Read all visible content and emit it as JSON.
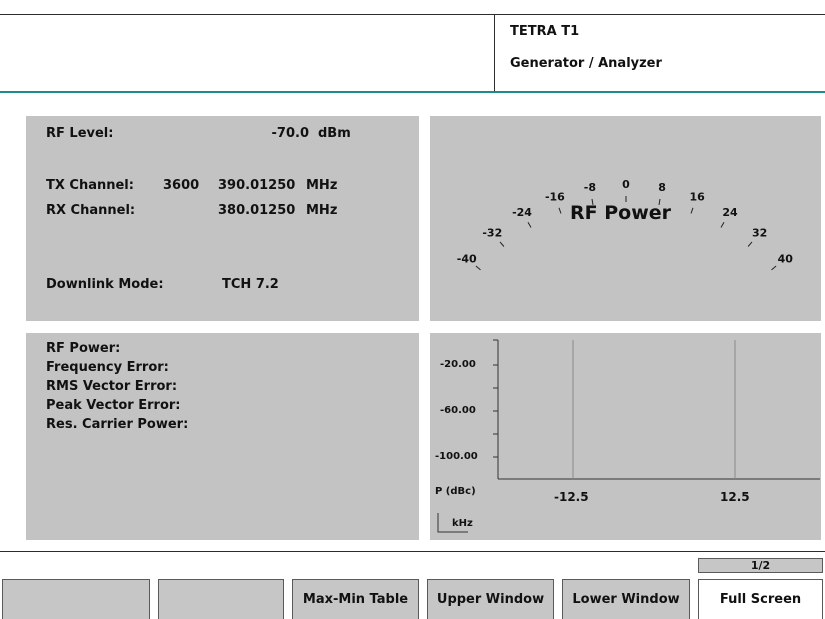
{
  "header": {
    "line1": "TETRA T1",
    "line2": "Generator / Analyzer"
  },
  "settings": {
    "rf_level_label": "RF Level:",
    "rf_level_value": "-70.0",
    "rf_level_unit": "dBm",
    "tx_label": "TX Channel:",
    "tx_channel": "3600",
    "tx_freq": "390.01250",
    "tx_unit": "MHz",
    "rx_label": "RX Channel:",
    "rx_freq": "380.01250",
    "rx_unit": "MHz",
    "downlink_label": "Downlink Mode:",
    "downlink_value": "TCH 7.2"
  },
  "meter": {
    "title": "RF Power",
    "ticks": [
      "-40",
      "-32",
      "-24",
      "-16",
      "-8",
      "0",
      "8",
      "16",
      "24",
      "32",
      "40"
    ]
  },
  "results": {
    "items": [
      "RF Power:",
      "Frequency Error:",
      "RMS Vector Error:",
      "Peak Vector Error:",
      "Res. Carrier Power:"
    ]
  },
  "spectrum": {
    "y_ticks": [
      "-20.00",
      "-60.00",
      "-100.00"
    ],
    "y_unit": "P (dBc)",
    "x_ticks": [
      "-12.5",
      "12.5"
    ],
    "x_unit": "kHz"
  },
  "page_indicator": "1/2",
  "softkeys": [
    "",
    "",
    "Max-Min Table",
    "Upper Window",
    "Lower Window",
    "Full Screen"
  ],
  "colors": {
    "panel": "#c3c3c3",
    "header_rule": "#1f8a8a",
    "softkey": "#c6c6c6",
    "softkey_active": "#ffffff"
  }
}
